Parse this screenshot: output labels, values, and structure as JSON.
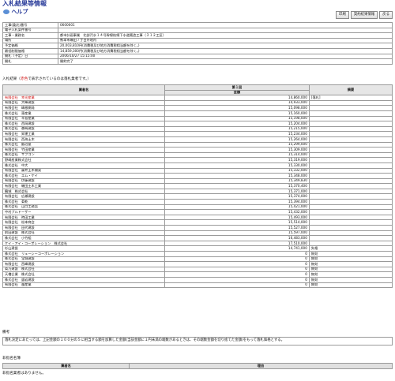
{
  "title": "入札結果等情報",
  "help_label": "ヘルプ",
  "buttons": [
    "印刷",
    "契約結果情報",
    "戻る"
  ],
  "info_rows": [
    {
      "label": "工事(委託)番号",
      "value": "0600001"
    },
    {
      "label": "電子入札案件番号",
      "value": ""
    },
    {
      "label": "工事・業務名",
      "value": "都市計画事業　北部汚水１４号幹線枝線下水道築造工事（３１２工区）"
    },
    {
      "label": "場所",
      "value": "熊本市麻田７丁目外地内"
    },
    {
      "label": "予定価格",
      "value": "20,003,810円(消費税及び地方消費税相当額を除く。)"
    },
    {
      "label": "最低制限価格",
      "value": "14,859,300円(消費税及び地方消費税相当額を除く。)"
    },
    {
      "label": "開札（予定）日",
      "value": "2006/10/27 15:15:00"
    },
    {
      "label": "開札",
      "value": "開約完了"
    }
  ],
  "results_caption_pre": "入札結果（",
  "results_caption_red": "赤色",
  "results_caption_post": "で表示されているのは落札業者です。）",
  "results_header": {
    "name": "業者名",
    "round": "第１回",
    "amount": "金額",
    "remarks": "摘要"
  },
  "results": [
    {
      "name": "有限会社　幸光産業",
      "amount": "14,860,000",
      "remark": "[落札]",
      "red": true
    },
    {
      "name": "有限会社　大峰建設",
      "amount": "14,933,000",
      "remark": ""
    },
    {
      "name": "有限会社　嶋根開発",
      "amount": "15,098,000",
      "remark": ""
    },
    {
      "name": "株式会社　東産業",
      "amount": "15,160,000",
      "remark": ""
    },
    {
      "name": "有限会社　辛島産業",
      "amount": "15,198,000",
      "remark": ""
    },
    {
      "name": "株式会社　西岡建設",
      "amount": "15,204,000",
      "remark": ""
    },
    {
      "name": "株式会社　森崎建設",
      "amount": "15,215,000",
      "remark": ""
    },
    {
      "name": "有限会社　昇運工業",
      "amount": "15,234,000",
      "remark": ""
    },
    {
      "name": "有限会社　西海土木",
      "amount": "15,264,000",
      "remark": ""
    },
    {
      "name": "株式会社　鍛冶屋",
      "amount": "15,299,000",
      "remark": ""
    },
    {
      "name": "有限会社　竹田産業",
      "amount": "15,309,000",
      "remark": ""
    },
    {
      "name": "株式会社　サプコン",
      "amount": "15,314,000",
      "remark": ""
    },
    {
      "name": "野崎産業株式会社",
      "amount": "15,319,000",
      "remark": ""
    },
    {
      "name": "株式会社　中大",
      "amount": "15,330,000",
      "remark": ""
    },
    {
      "name": "有限会社　藤井土木開発",
      "amount": "15,332,000",
      "remark": ""
    },
    {
      "name": "株式会社　エム・ケイ",
      "amount": "15,348,000",
      "remark": ""
    },
    {
      "name": "有限会社　伊藤建設",
      "amount": "15,349,830",
      "remark": ""
    },
    {
      "name": "有限会社　磯田土木工業",
      "amount": "15,370,400",
      "remark": ""
    },
    {
      "name": "鶴城　株式会社",
      "amount": "15,371,000",
      "remark": ""
    },
    {
      "name": "有限会社　広瀬建設",
      "amount": "15,374,000",
      "remark": ""
    },
    {
      "name": "株式会社　菊乾",
      "amount": "15,394,000",
      "remark": ""
    },
    {
      "name": "株式会社　山口工務店",
      "amount": "15,421,000",
      "remark": ""
    },
    {
      "name": "中村ブルドーザー",
      "amount": "15,432,000",
      "remark": ""
    },
    {
      "name": "有限会社　時田工業",
      "amount": "15,493,000",
      "remark": ""
    },
    {
      "name": "有限会社　松本商会",
      "amount": "15,514,000",
      "remark": ""
    },
    {
      "name": "有限会社　田代建設",
      "amount": "15,527,000",
      "remark": ""
    },
    {
      "name": "前田建設　株式会社",
      "amount": "15,597,000",
      "remark": ""
    },
    {
      "name": "株式会社　小竹組",
      "amount": "16,483,000",
      "remark": ""
    },
    {
      "name": "ケイ・アイ・コーポレーション　株式会社",
      "amount": "17,510,000",
      "remark": ""
    },
    {
      "name": "杉山建設",
      "amount": "14,741,000",
      "remark": "失格"
    },
    {
      "name": "株式会社　リューシーコーポレーション",
      "amount": "0",
      "remark": "無効"
    },
    {
      "name": "株式会社　宝城建設",
      "amount": "0",
      "remark": "無効"
    },
    {
      "name": "有限会社　西峰建設",
      "amount": "0",
      "remark": "無効"
    },
    {
      "name": "菊乃建設　株式会社",
      "amount": "0",
      "remark": "無効"
    },
    {
      "name": "天櫓企業　株式会社",
      "amount": "0",
      "remark": "無効"
    },
    {
      "name": "株式会社　盛岩建設",
      "amount": "0",
      "remark": "無効"
    },
    {
      "name": "有限会社　嵐産業",
      "amount": "0",
      "remark": "無効"
    }
  ],
  "remarks_label": "備考",
  "remarks_text": "落札決定にあたっては、上記金額の１００分の５に相当する額を加算した金額(当該金額に１円未満の端数があるときは、その端数金額を切り捨てた金額)をもって落札価格とする。",
  "nominee_label": "非指名名簿",
  "nominee_header": {
    "name": "業者名",
    "reason": "理由"
  },
  "nominee_empty": "非指名業者はありません。"
}
